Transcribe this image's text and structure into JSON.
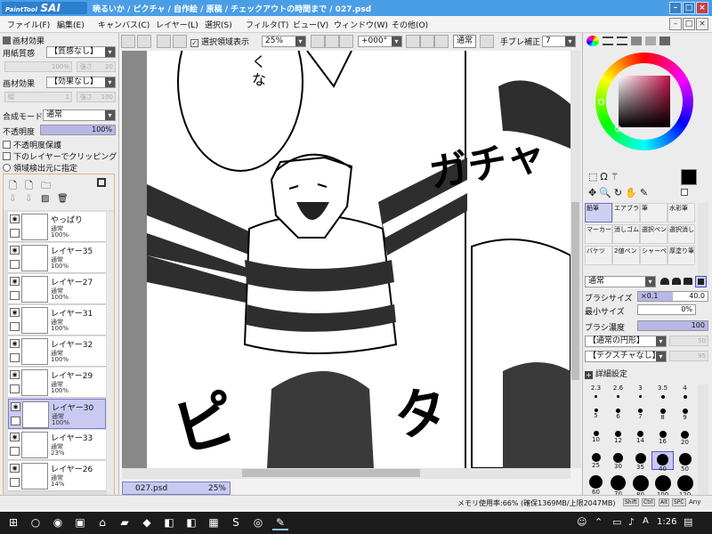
{
  "window": {
    "logo_top": "PaintTool",
    "logo_main": "SAI",
    "title": "暁るいか / ピクチャ / 自作絵 / 原稿 / チェックアウトの時間まで / 027.psd",
    "controls": [
      "–",
      "□",
      "×"
    ],
    "doc_controls": [
      "–",
      "□",
      "×"
    ]
  },
  "menu": [
    "ファイル(F)",
    "編集(E)",
    "キャンバス(C)",
    "レイヤー(L)",
    "選択(S)",
    "フィルタ(T)",
    "ビュー(V)",
    "ウィンドウ(W)",
    "その他(O)"
  ],
  "toolbar": {
    "selection_display_label": "選択領域表示",
    "selection_display_checked": true,
    "zoom": "25%",
    "rotation": "+000°",
    "mode": "通常",
    "stabilizer_label": "手ブレ補正",
    "stabilizer_value": "7"
  },
  "texture_panel": {
    "header": "画材効果",
    "paper_label": "用紙質感",
    "paper_value": "【質感なし】",
    "paper_scale": "100%",
    "paper_strength_label": "強さ",
    "paper_strength": "20",
    "effect_label": "画材効果",
    "effect_value": "【効果なし】",
    "effect_width_label": "幅",
    "effect_width": "1",
    "effect_strength_label": "強さ",
    "effect_strength": "100"
  },
  "layer_props": {
    "blend_label": "合成モード",
    "blend_value": "通常",
    "opacity_label": "不透明度",
    "opacity_value": "100%",
    "opacity_fraction": 1.0,
    "protect_opacity": "不透明度保護",
    "clip_lower": "下のレイヤーでクリッピング",
    "selection_source": "領域検出元に指定"
  },
  "layers": [
    {
      "name": "やっぱり",
      "mode": "通常",
      "opacity": "100%",
      "active": false
    },
    {
      "name": "レイヤー35",
      "mode": "通常",
      "opacity": "100%",
      "active": false
    },
    {
      "name": "レイヤー27",
      "mode": "通常",
      "opacity": "100%",
      "active": false
    },
    {
      "name": "レイヤー31",
      "mode": "通常",
      "opacity": "100%",
      "active": false
    },
    {
      "name": "レイヤー32",
      "mode": "通常",
      "opacity": "100%",
      "active": false
    },
    {
      "name": "レイヤー29",
      "mode": "通常",
      "opacity": "100%",
      "active": false
    },
    {
      "name": "レイヤー30",
      "mode": "通常",
      "opacity": "100%",
      "active": true
    },
    {
      "name": "レイヤー33",
      "mode": "通常",
      "opacity": "23%",
      "active": false
    },
    {
      "name": "レイヤー26",
      "mode": "通常",
      "opacity": "14%",
      "active": false
    }
  ],
  "manga": {
    "bubble_text": [
      "く",
      "な"
    ],
    "sfx_1": "ガチャ",
    "sfx_2": "ピ",
    "sfx_3": "タ"
  },
  "doc_tab": {
    "name": "027.psd",
    "zoom": "25%"
  },
  "colors": {
    "primary": "#000000",
    "secondary": "#ffffff",
    "accent": "#4a9ee6",
    "wheel_center": "#7a1030"
  },
  "tools": [
    {
      "label": "鉛筆",
      "active": true
    },
    {
      "label": "エアブラシ",
      "active": false
    },
    {
      "label": "筆",
      "active": false
    },
    {
      "label": "水彩筆",
      "active": false
    },
    {
      "label": "マーカー",
      "active": false
    },
    {
      "label": "消しゴム",
      "active": false
    },
    {
      "label": "選択ペン",
      "active": false
    },
    {
      "label": "選択消し",
      "active": false
    },
    {
      "label": "バケツ",
      "active": false
    },
    {
      "label": "2値ペン",
      "active": false
    },
    {
      "label": "シャーペン",
      "active": false
    },
    {
      "label": "厚塗り筆",
      "active": false
    }
  ],
  "brush": {
    "mode": "通常",
    "size_label": "ブラシサイズ",
    "size_mult": "×0.1",
    "size_value": "40.0",
    "size_fraction": 0.5,
    "min_size_label": "最小サイズ",
    "min_size_value": "0%",
    "density_label": "ブラシ濃度",
    "density_value": "100",
    "density_fraction": 1.0,
    "shape": "【通常の円形】",
    "shape_value": "50",
    "texture": "【テクスチャなし】",
    "texture_value": "95",
    "detail_label": "詳細設定",
    "presets": [
      "2.3",
      "2.6",
      "3",
      "3.5",
      "4",
      "5",
      "6",
      "7",
      "8",
      "9",
      "10",
      "12",
      "14",
      "16",
      "20",
      "25",
      "30",
      "35",
      "40",
      "50",
      "60",
      "70",
      "80",
      "100",
      "120"
    ],
    "selected_preset": "40"
  },
  "status": {
    "memory": "メモリ使用率:66% (確保1369MB/上限2047MB)",
    "keys": [
      "Shift",
      "Ctrl",
      "Alt",
      "SPC"
    ],
    "any": "Any"
  },
  "taskbar": {
    "time": "1:26",
    "apps": [
      "windows-icon",
      "search-icon",
      "chrome-icon",
      "store-icon",
      "home-icon",
      "folder-icon",
      "evernote-icon",
      "app-icon",
      "app-icon",
      "gallery-icon",
      "skype-icon",
      "browser-icon",
      "sai-icon"
    ]
  }
}
